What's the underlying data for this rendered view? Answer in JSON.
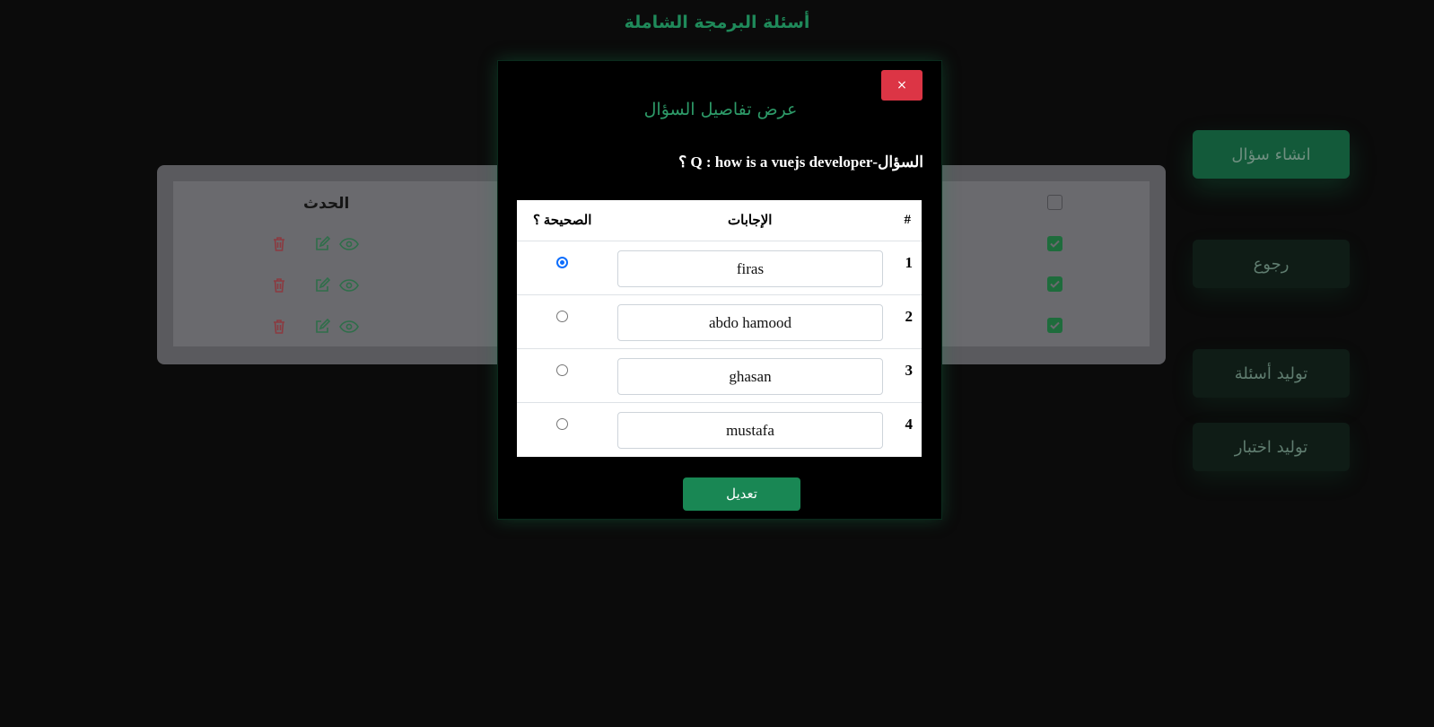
{
  "header": {
    "title": "أسئلة البرمجة الشاملة"
  },
  "nav": {
    "items": [
      {
        "label": "انشاء سؤال"
      },
      {
        "label": "رجوع"
      },
      {
        "label": "توليد أسئلة"
      },
      {
        "label": "توليد اختبار"
      }
    ]
  },
  "table": {
    "header_label": "الحدث",
    "row_count": 3
  },
  "modal": {
    "title": "عرض تفاصيل السؤال",
    "close_label": "×",
    "question": "السؤال-Q : how is a vuejs developer ؟",
    "columns": {
      "index": "#",
      "answers": "الإجابات",
      "correct": "الصحيحة ؟"
    },
    "answers": [
      {
        "index": "1",
        "text": "firas",
        "correct": true
      },
      {
        "index": "2",
        "text": "abdo hamood",
        "correct": false
      },
      {
        "index": "3",
        "text": "ghasan",
        "correct": false
      },
      {
        "index": "4",
        "text": "mustafa",
        "correct": false
      }
    ],
    "submit_label": "تعديل"
  },
  "colors": {
    "accent": "#198754",
    "danger": "#dc3545",
    "radio_checked": "#0d6efd",
    "background": "#0b0b0b"
  }
}
